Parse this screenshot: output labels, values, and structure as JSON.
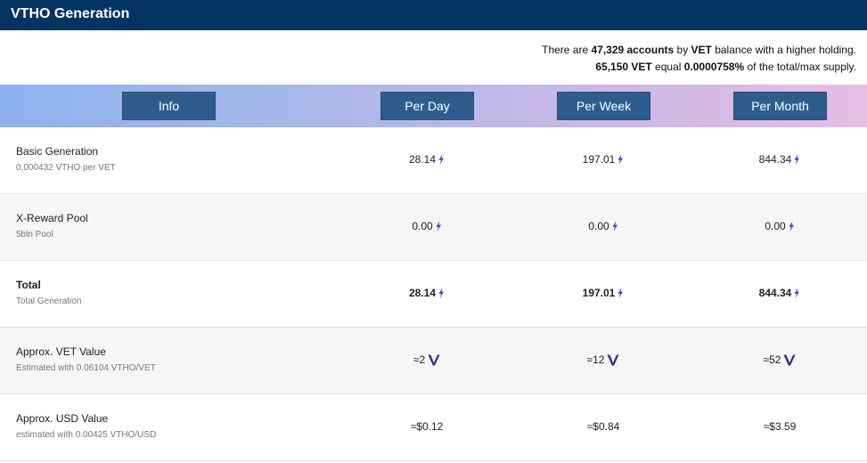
{
  "header": {
    "title": "VTHO Generation"
  },
  "summary": {
    "line1_prefix": "There are ",
    "accounts": "47,329 accounts",
    "line1_mid": " by ",
    "vet": "VET",
    "line1_suffix": " balance with a higher holding.",
    "amount": "65,150 VET",
    "line2_mid": " equal ",
    "percent": "0.0000758%",
    "line2_suffix": " of the total/max supply."
  },
  "columns": {
    "info": "Info",
    "day": "Per Day",
    "week": "Per Week",
    "month": "Per Month"
  },
  "rows": [
    {
      "label": "Basic Generation",
      "sub": "0,000432 VTHO per VET",
      "day": "28.14",
      "week": "197.01",
      "month": "844.34",
      "icon": "vtho-bolt-icon"
    },
    {
      "label": "X-Reward Pool",
      "sub": "5bln Pool",
      "day": "0.00",
      "week": "0.00",
      "month": "0.00",
      "icon": "vtho-bolt-icon"
    },
    {
      "label": "Total",
      "sub": "Total Generation",
      "day": "28.14",
      "week": "197.01",
      "month": "844.34",
      "icon": "vtho-bolt-icon"
    },
    {
      "label": "Approx. VET Value",
      "sub": "Estimated with 0.06104 VTHO/VET",
      "day": "≈2",
      "week": "≈12",
      "month": "≈52",
      "icon": "vet-logo-icon"
    },
    {
      "label": "Approx. USD Value",
      "sub": "estimated with 0.00425 VTHO/USD",
      "day": "≈$0.12",
      "week": "≈$0.84",
      "month": "≈$3.59"
    }
  ],
  "colors": {
    "title_bg": "#033363",
    "button_bg": "#2e5d8d",
    "bolt": "#2a4bd8",
    "vet_logo": "#3a2a8a"
  }
}
